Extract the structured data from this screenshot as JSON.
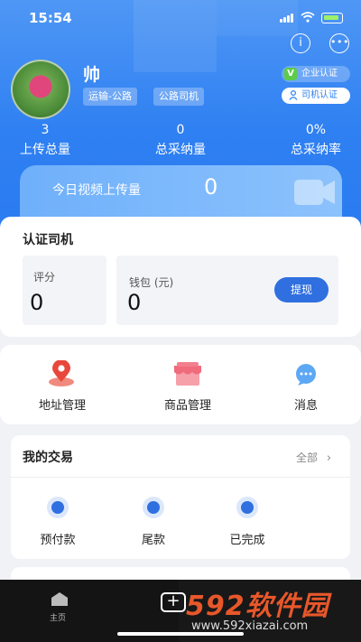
{
  "status_bar": {
    "time": "15:54"
  },
  "profile": {
    "name": "帅",
    "tags": [
      "运输-公路",
      "公路司机"
    ],
    "enterprise_cert": "企业认证",
    "enterprise_badge": "V",
    "driver_cert": "司机认证"
  },
  "stats": [
    {
      "value": "3",
      "label": "上传总量"
    },
    {
      "value": "0",
      "label": "总采纳量"
    },
    {
      "value": "0%",
      "label": "总采纳率"
    }
  ],
  "video_banner": {
    "label": "今日视频上传量",
    "count": "0"
  },
  "driver_card": {
    "title": "认证司机",
    "score_label": "评分",
    "score_value": "0",
    "wallet_label": "钱包 (元)",
    "wallet_value": "0",
    "withdraw_button": "提现"
  },
  "services": [
    {
      "label": "地址管理",
      "icon": "location-pin-icon"
    },
    {
      "label": "商品管理",
      "icon": "shop-icon"
    },
    {
      "label": "消息",
      "icon": "message-icon"
    }
  ],
  "transactions": {
    "title": "我的交易",
    "all_link": "全部",
    "items": [
      {
        "label": "预付款"
      },
      {
        "label": "尾款"
      },
      {
        "label": "已完成"
      }
    ]
  },
  "tab_bar": {
    "home_label": "主页"
  },
  "watermark": {
    "text": "592软件园",
    "url": "www.592xiazai.com"
  },
  "colors": {
    "primary": "#2f80f2",
    "accent_button": "#2f6fe0",
    "badge_green": "#5ecb4a",
    "icon_red": "#e8483c",
    "icon_pink": "#f06b7c"
  }
}
